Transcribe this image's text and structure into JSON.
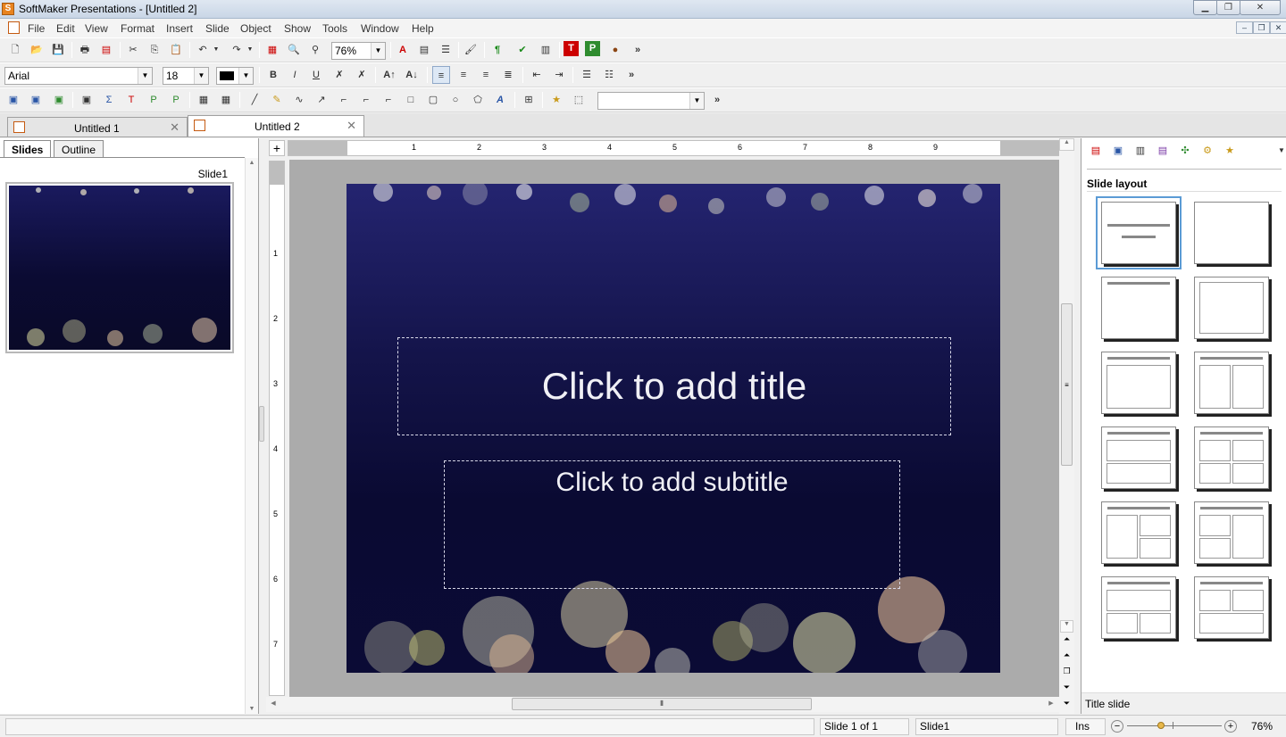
{
  "window": {
    "title": "SoftMaker Presentations - [Untitled 2]",
    "app_icon": "S"
  },
  "menu": [
    "File",
    "Edit",
    "View",
    "Format",
    "Insert",
    "Slide",
    "Object",
    "Show",
    "Tools",
    "Window",
    "Help"
  ],
  "toolbar": {
    "zoom": "76%",
    "font": "Arial",
    "size": "18",
    "more": "»"
  },
  "tabs": [
    {
      "label": "Untitled 1"
    },
    {
      "label": "Untitled 2"
    }
  ],
  "left_panel": {
    "tab_slides": "Slides",
    "tab_outline": "Outline",
    "slide_label": "Slide1"
  },
  "ruler": {
    "h": [
      "1",
      "2",
      "3",
      "4",
      "5",
      "6",
      "7",
      "8",
      "9"
    ],
    "v": [
      "1",
      "2",
      "3",
      "4",
      "5",
      "6",
      "7"
    ]
  },
  "slide": {
    "title_placeholder": "Click to add title",
    "subtitle_placeholder": "Click to add subtitle"
  },
  "right_panel": {
    "heading": "Slide layout",
    "selected_name": "Title slide"
  },
  "status": {
    "slide_pos": "Slide 1 of 1",
    "slide_name": "Slide1",
    "mode": "Ins",
    "zoom": "76%"
  },
  "colors": {
    "accent": "#5b9bd5",
    "slide_top": "#242470",
    "slide_bottom": "#0a0a32",
    "text_color_swatch": "#000000"
  },
  "icons": [
    "new-icon",
    "open-icon",
    "save-icon",
    "print-icon",
    "pdf-icon",
    "cut-icon",
    "copy-icon",
    "paste-icon",
    "undo-icon",
    "redo-icon",
    "zoom-icon",
    "bold-icon",
    "italic-icon",
    "underline-icon",
    "align-left-icon",
    "line-icon",
    "rectangle-icon",
    "ellipse-icon",
    "star-icon"
  ]
}
